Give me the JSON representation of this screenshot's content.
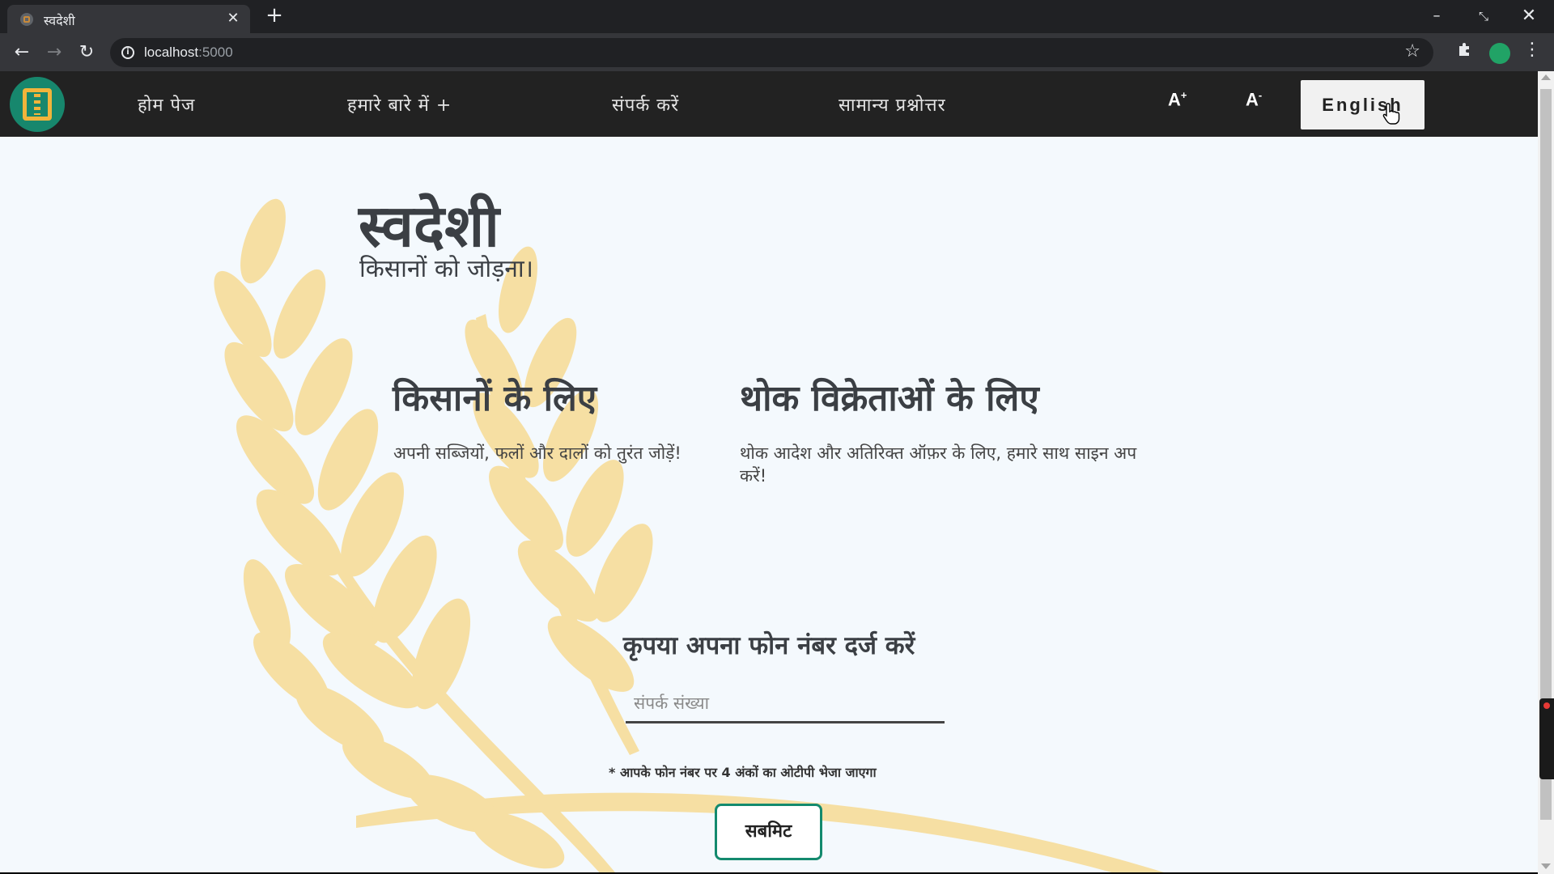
{
  "browser": {
    "tab_title": "स्वदेशी",
    "tab_close_glyph": "✕",
    "new_tab_glyph": "+",
    "url_host": "localhost",
    "url_port": ":5000",
    "window_controls": {
      "minimize": "–",
      "maximize": "⤡",
      "close": "✕"
    }
  },
  "navbar": {
    "links": [
      {
        "label": "होम पेज"
      },
      {
        "label": "हमारे बारे में +"
      },
      {
        "label": "संपर्क करें"
      },
      {
        "label": "सामान्य प्रश्नोत्तर"
      }
    ],
    "font_increase": "A",
    "font_increase_sup": "+",
    "font_decrease": "A",
    "font_decrease_sup": "-",
    "language_button": "English"
  },
  "hero": {
    "title": "स्वदेशी",
    "subtitle": "किसानों को जोड़ना।"
  },
  "columns": {
    "farmers": {
      "title": "किसानों के लिए",
      "text": "अपनी सब्जियों, फलों और दालों को तुरंत जोड़ें!"
    },
    "wholesalers": {
      "title": "थोक विक्रेताओं के लिए",
      "text": "थोक आदेश और अतिरिक्त ऑफ़र के लिए, हमारे साथ साइन अप करें!"
    }
  },
  "form": {
    "title": "कृपया अपना फोन नंबर दर्ज करें",
    "phone_placeholder": "संपर्क संख्या",
    "phone_value": "",
    "otp_note": "* आपके फोन नंबर पर 4 अंकों का ओटीपी भेजा जाएगा",
    "submit_label": "सबमिट"
  },
  "colors": {
    "navbar_bg": "#222222",
    "page_bg": "#f4f9fd",
    "brand_teal": "#17876d",
    "wheat": "#f6dfa3",
    "submit_border": "#138a6e"
  },
  "icons": {
    "back": "arrow-left-icon",
    "forward": "arrow-right-icon",
    "reload": "reload-icon",
    "info": "info-icon",
    "bookmark": "star-icon",
    "extensions": "puzzle-icon",
    "profile": "profile-icon",
    "menu": "kebab-menu-icon",
    "logo": "wheat-logo-icon"
  }
}
